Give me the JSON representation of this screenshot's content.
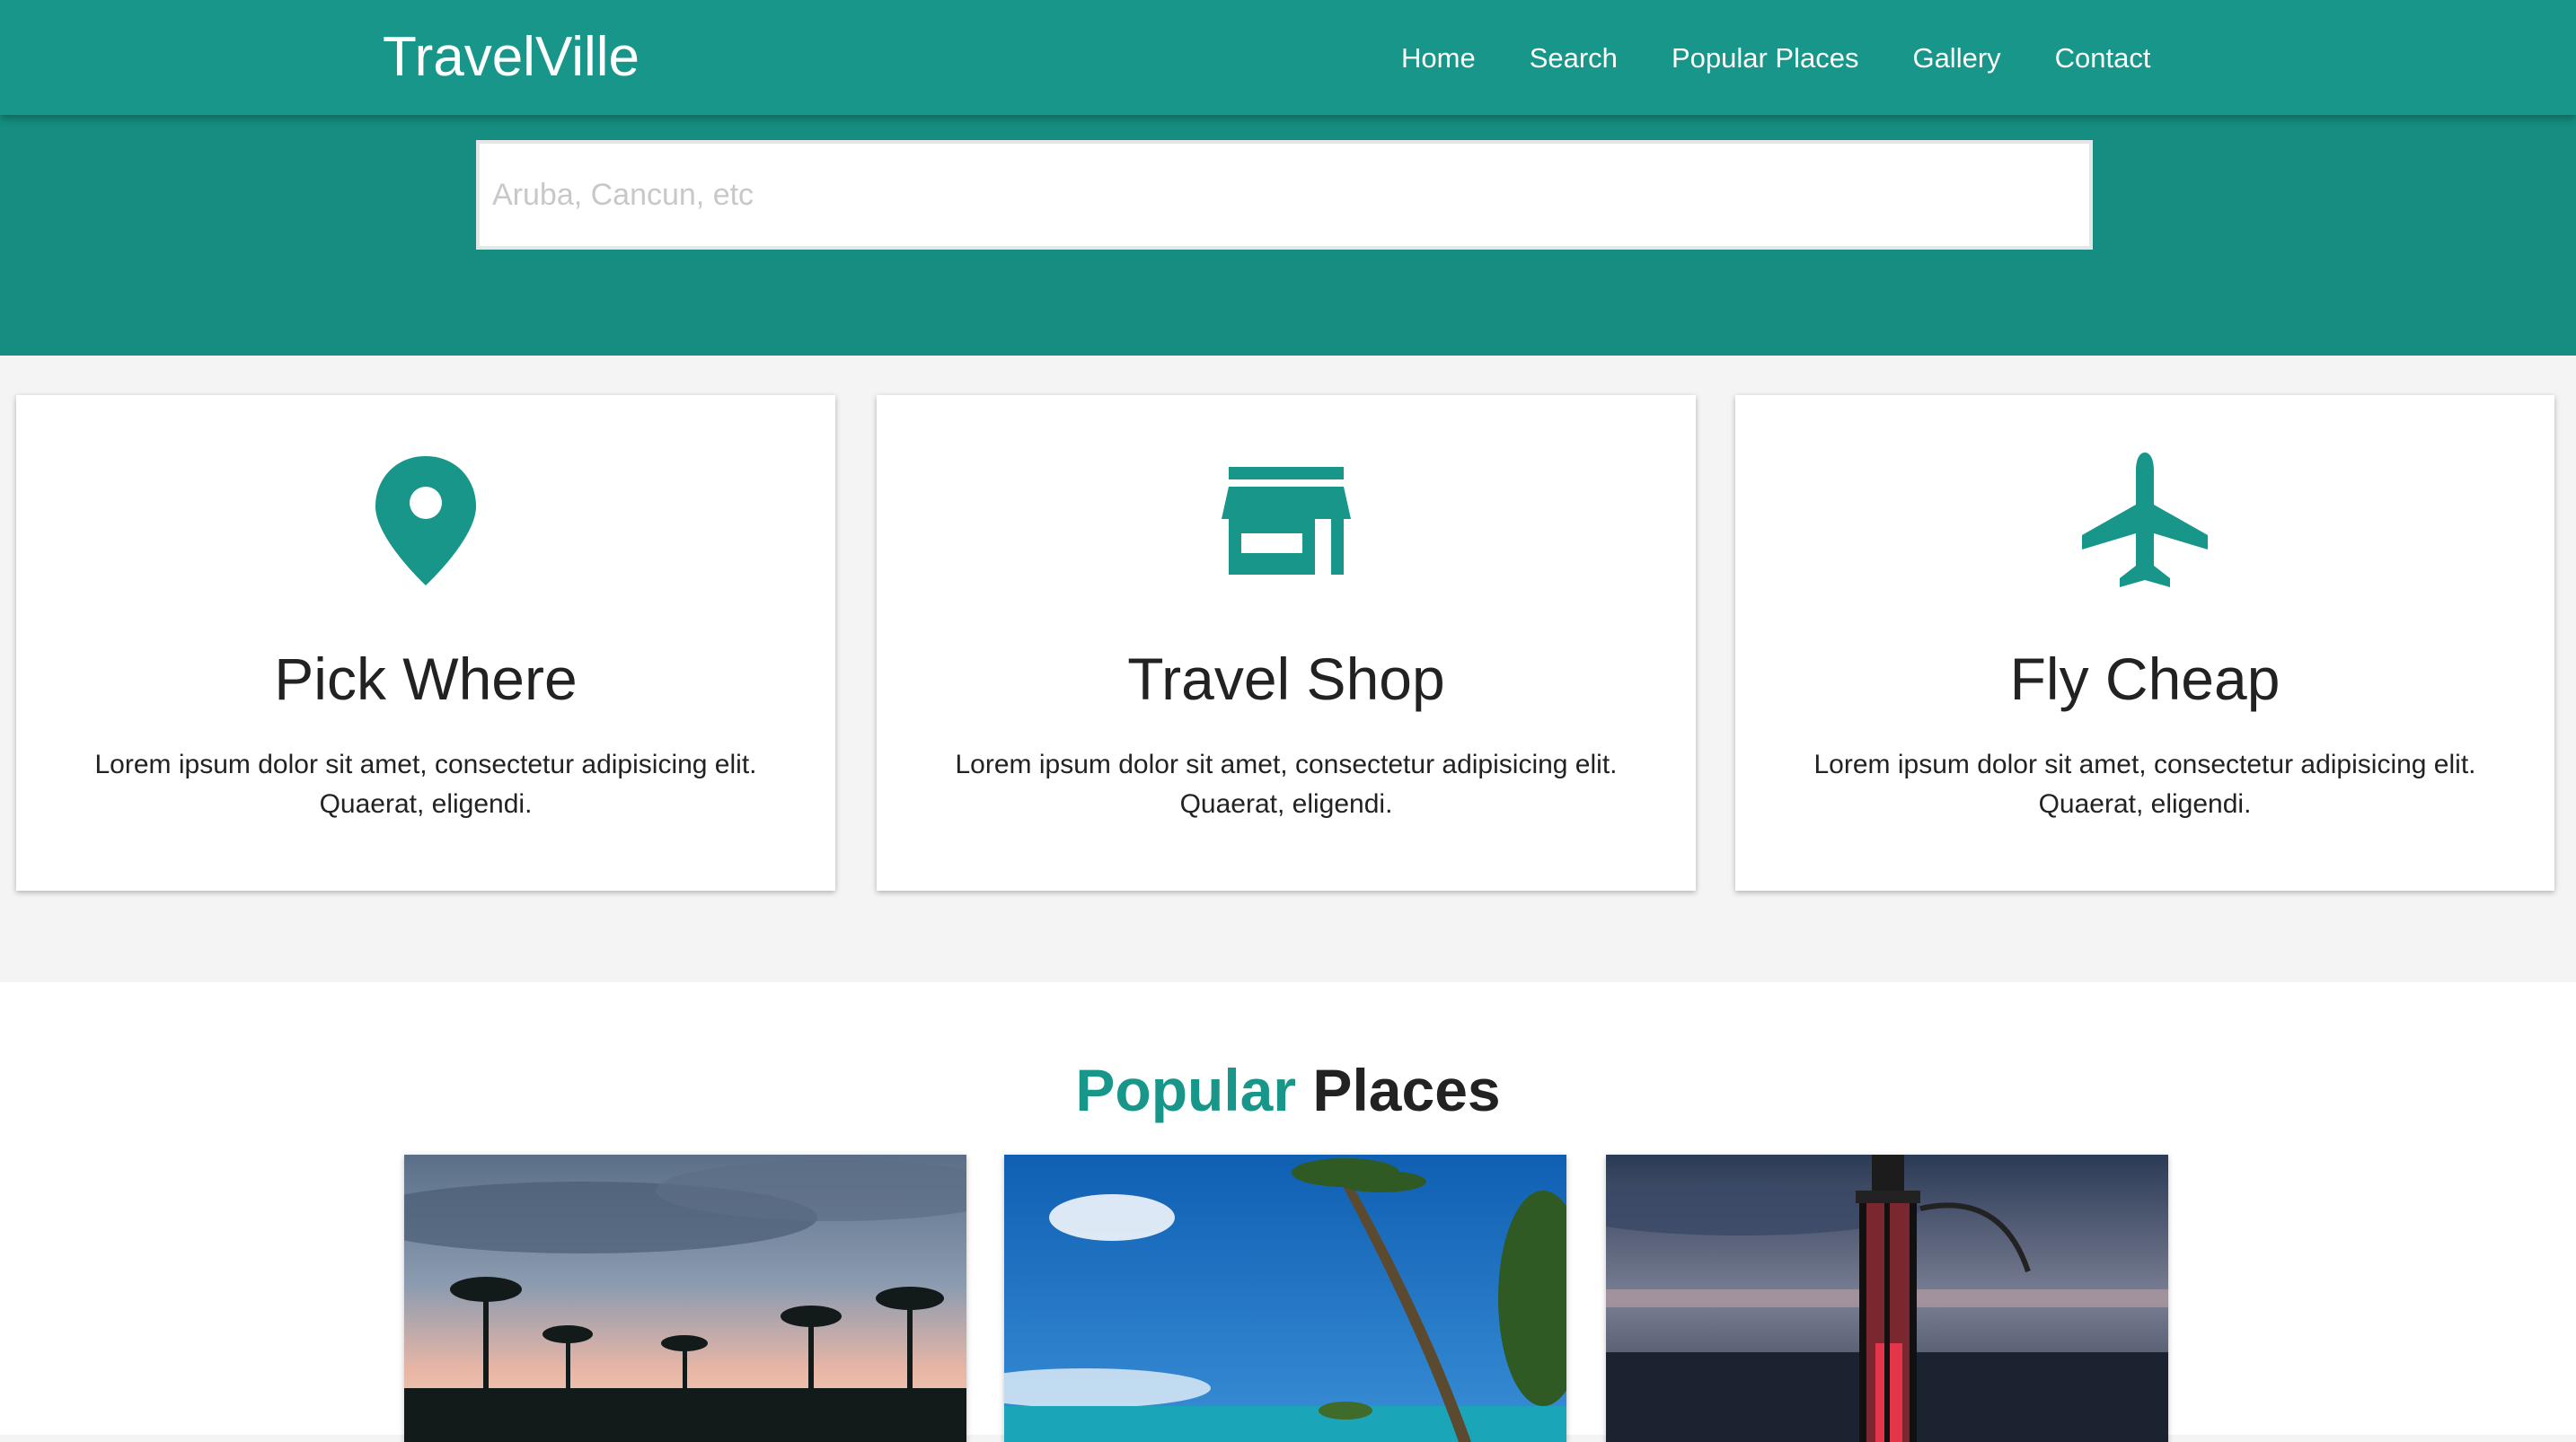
{
  "navbar": {
    "brand": "TravelVille",
    "links": [
      "Home",
      "Search",
      "Popular Places",
      "Gallery",
      "Contact"
    ]
  },
  "search": {
    "placeholder": "Aruba, Cancun, etc"
  },
  "features": [
    {
      "icon": "map-marker-icon",
      "title": "Pick Where",
      "text": "Lorem ipsum dolor sit amet, consectetur adipisicing elit. Quaerat, eligendi."
    },
    {
      "icon": "store-icon",
      "title": "Travel Shop",
      "text": "Lorem ipsum dolor sit amet, consectetur adipisicing elit. Quaerat, eligendi."
    },
    {
      "icon": "airplane-icon",
      "title": "Fly Cheap",
      "text": "Lorem ipsum dolor sit amet, consectetur adipisicing elit. Quaerat, eligendi."
    }
  ],
  "popular": {
    "title_accent": "Popular",
    "title_rest": "Places",
    "images": [
      "palm-sunset-photo",
      "beach-palm-photo",
      "lantern-photo"
    ]
  },
  "colors": {
    "brand": "#179689",
    "band": "#158d80",
    "background": "#f4f4f4"
  }
}
